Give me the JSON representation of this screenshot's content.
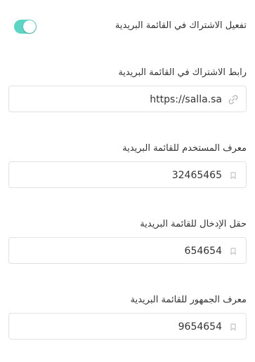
{
  "toggle": {
    "label": "تفعيل الاشتراك في القائمة البريدية",
    "enabled": true,
    "accent_color": "#5dd5c4"
  },
  "fields": [
    {
      "label": "رابط الاشتراك في القائمة البريدية",
      "value": "https://salla.sa",
      "icon": "link-icon"
    },
    {
      "label": "معرف المستخدم للقائمة البريدية",
      "value": "32465465",
      "icon": "bookmark-icon"
    },
    {
      "label": "حقل الإدخال للقائمة البريدية",
      "value": "654654",
      "icon": "bookmark-icon"
    },
    {
      "label": "معرف الجمهور للقائمة البريدية",
      "value": "9654654",
      "icon": "bookmark-icon"
    }
  ]
}
